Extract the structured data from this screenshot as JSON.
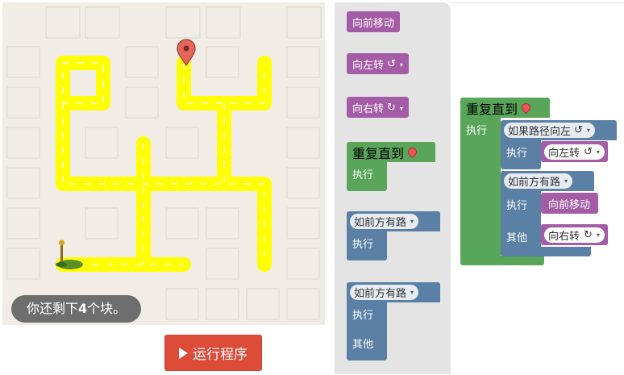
{
  "counter": {
    "prefix": "你还剩下",
    "count": "4",
    "suffix": "个块。"
  },
  "run_button": {
    "label": "运行程序"
  },
  "toolbox": {
    "move_forward": "向前移动",
    "turn_left": "向左转",
    "turn_right": "向右转",
    "turn_left_symbol": "↺",
    "turn_right_symbol": "↻",
    "repeat_until": "重复直到",
    "do": "执行",
    "if_path_ahead": "如前方有路",
    "if_else_path_ahead": "如前方有路",
    "else": "其他"
  },
  "workspace": {
    "repeat_until": "重复直到",
    "do": "执行",
    "if_condition": "如果路径向左",
    "if_symbol": "↺",
    "turn_left": "向左转",
    "turn_left_symbol": "↺",
    "ifelse_condition": "如前方有路",
    "move_forward": "向前移动",
    "else": "其他",
    "turn_right": "向右转",
    "turn_right_symbol": "↻"
  },
  "colors": {
    "movement": "#a55ca6",
    "loop": "#59a559",
    "logic": "#5b80a5",
    "path": "#ffff00",
    "run": "#dd4b39"
  }
}
